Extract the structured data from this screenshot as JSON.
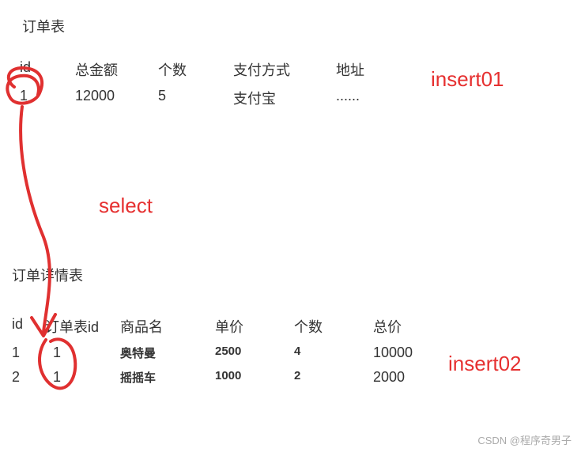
{
  "table1": {
    "title": "订单表",
    "headers": [
      "id",
      "总金额",
      "个数",
      "支付方式",
      "地址"
    ],
    "row": {
      "id": "1",
      "total": "12000",
      "count": "5",
      "pay": "支付宝",
      "addr": "......"
    }
  },
  "table2": {
    "title": "订单详情表",
    "headers": [
      "id",
      "订单表id",
      "商品名",
      "单价",
      "个数",
      "总价"
    ],
    "rows": [
      {
        "id": "1",
        "oid": "1",
        "name": "奥特曼",
        "price": "2500",
        "count": "4",
        "total": "10000"
      },
      {
        "id": "2",
        "oid": "1",
        "name": "摇摇车",
        "price": "1000",
        "count": "2",
        "total": "2000"
      }
    ]
  },
  "annotations": {
    "insert01": "insert01",
    "select": "select",
    "insert02": "insert02"
  },
  "watermark": "CSDN @程序奇男子"
}
